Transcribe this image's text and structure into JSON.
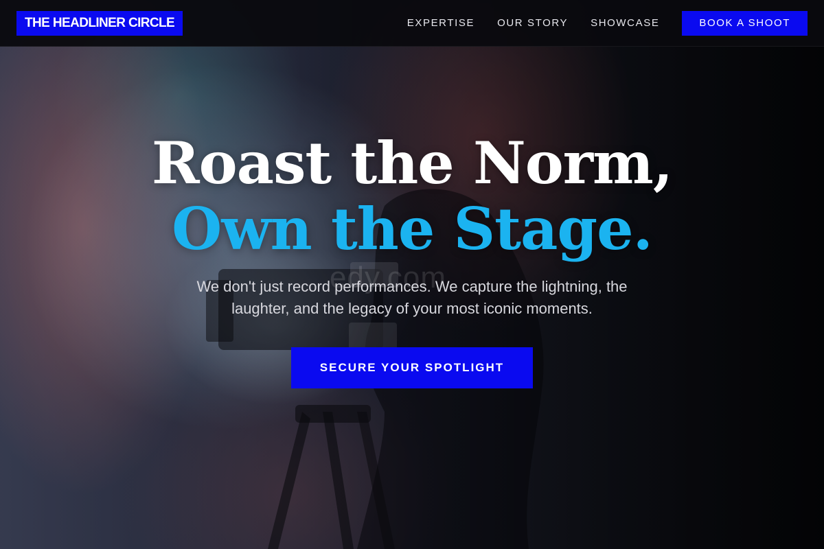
{
  "nav": {
    "logo": "THE HEADLINER CIRCLE",
    "links": [
      "EXPERTISE",
      "OUR STORY",
      "SHOWCASE"
    ],
    "cta": "BOOK A SHOOT"
  },
  "hero": {
    "headline_line1": "Roast the Norm,",
    "headline_line2": "Own the Stage.",
    "subtext": "We don't just record performances. We capture the lightning, the laughter, and the legacy of your most iconic moments.",
    "cta": "SECURE YOUR SPOTLIGHT",
    "watermark": "edy.com"
  },
  "colors": {
    "brand_blue": "#0a0af0",
    "accent_cyan": "#1bb3f0",
    "nav_bg": "#0a0a0e"
  }
}
